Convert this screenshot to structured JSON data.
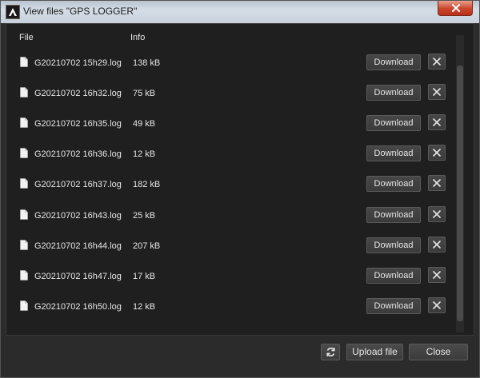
{
  "window": {
    "title": "View files \"GPS LOGGER\""
  },
  "table": {
    "headers": {
      "file": "File",
      "info": "Info"
    },
    "download_label": "Download",
    "rows": [
      {
        "name": "G20210702 15h29.log",
        "size": "138 kB"
      },
      {
        "name": "G20210702 16h32.log",
        "size": "75 kB"
      },
      {
        "name": "G20210702 16h35.log",
        "size": "49 kB"
      },
      {
        "name": "G20210702 16h36.log",
        "size": "12 kB"
      },
      {
        "name": "G20210702 16h37.log",
        "size": "182 kB"
      },
      {
        "name": "G20210702 16h43.log",
        "size": "25 kB"
      },
      {
        "name": "G20210702 16h44.log",
        "size": "207 kB"
      },
      {
        "name": "G20210702 16h47.log",
        "size": "17 kB"
      },
      {
        "name": "G20210702 16h50.log",
        "size": "12 kB"
      }
    ]
  },
  "footer": {
    "upload_label": "Upload file",
    "close_label": "Close"
  },
  "icons": {
    "app": "app-logo-icon",
    "window_close": "close-icon",
    "file": "file-icon",
    "delete": "close-icon",
    "refresh": "refresh-icon"
  },
  "colors": {
    "background": "#2b2b2b",
    "panel": "#1f1f1f",
    "button": "#424242",
    "text": "#e6e6e6",
    "titlebar": "#c8d1db",
    "window_close": "#c9452c"
  }
}
